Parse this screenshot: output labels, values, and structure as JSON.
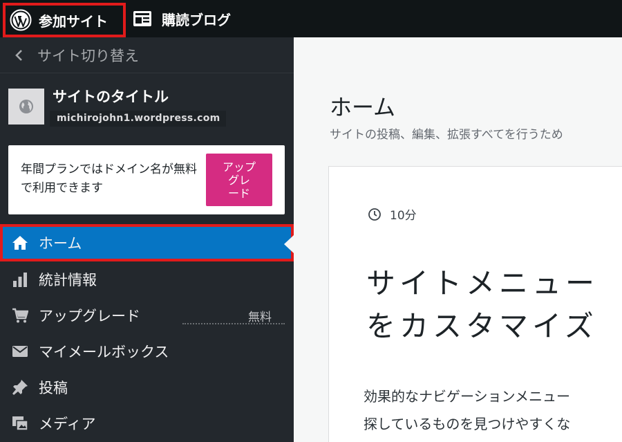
{
  "topbar": {
    "site_label": "参加サイト",
    "reader_label": "購読ブログ"
  },
  "sidebar": {
    "switch_label": "サイト切り替え",
    "site": {
      "title": "サイトのタイトル",
      "url": "michirojohn1.wordpress.com"
    },
    "promo": {
      "text": "年間プランではドメイン名が無料で利用できます",
      "button": "アップ\nグレ\nード"
    },
    "items": [
      {
        "label": "ホーム",
        "icon": "home-icon",
        "active": true
      },
      {
        "label": "統計情報",
        "icon": "stats-icon"
      },
      {
        "label": "アップグレード",
        "icon": "cart-icon",
        "badge": "無料"
      },
      {
        "label": "マイメールボックス",
        "icon": "mail-icon"
      },
      {
        "label": "投稿",
        "icon": "pin-icon"
      },
      {
        "label": "メディア",
        "icon": "media-icon"
      }
    ]
  },
  "main": {
    "title": "ホーム",
    "subtitle": "サイトの投稿、編集、拡張すべてを行うため",
    "card": {
      "time": "10分",
      "heading": "サイトメニュー\nをカスタマイズ",
      "body": "効果的なナビゲーションメニュー\n探しているものを見つけやすくな"
    }
  },
  "colors": {
    "topbar_bg": "#101517",
    "sidebar_bg": "#23282d",
    "active_bg": "#0675c4",
    "highlight_border": "#e11b1b",
    "upgrade_button": "#d52c82"
  }
}
